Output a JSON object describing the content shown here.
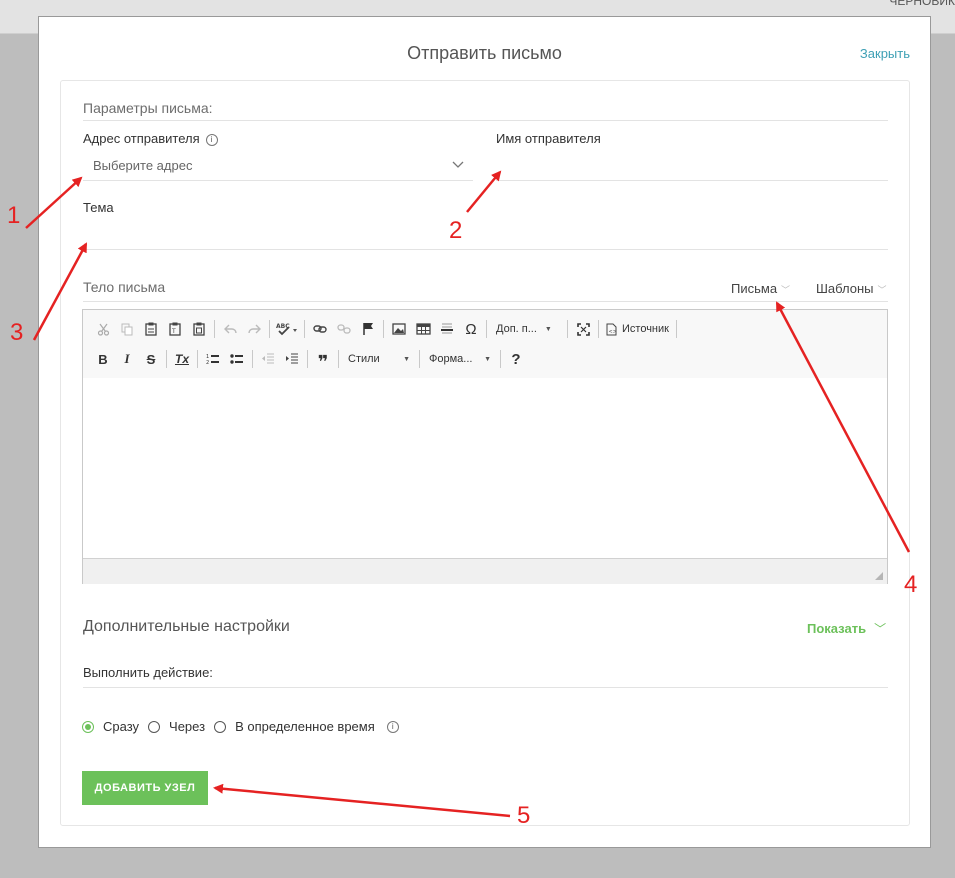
{
  "background": {
    "corner_text": "ЧЕРНОВИК"
  },
  "modal": {
    "title": "Отправить письмо",
    "close_label": "Закрыть"
  },
  "params": {
    "section_label": "Параметры письма:",
    "sender_address_label": "Адрес отправителя",
    "sender_address_placeholder": "Выберите адрес",
    "sender_name_label": "Имя отправителя",
    "subject_label": "Тема"
  },
  "body": {
    "label": "Тело письма",
    "letters_link": "Письма",
    "templates_link": "Шаблоны"
  },
  "editor": {
    "icons_row1": [
      "cut-icon",
      "copy-icon",
      "paste-icon",
      "paste-text-icon",
      "paste-word-icon",
      "undo-icon",
      "redo-icon",
      "spellcheck-icon",
      "link-icon",
      "unlink-icon",
      "anchor-icon",
      "image-icon",
      "table-icon",
      "horizontal-line-icon",
      "special-char-icon",
      "maximize-icon",
      "source-icon"
    ],
    "extra_combo": "Доп. п...",
    "source_label": "Источник",
    "styles_combo": "Стили",
    "format_combo": "Форма...",
    "help_glyph": "?",
    "bold_glyph": "B",
    "italic_glyph": "I",
    "strike_glyph": "S",
    "clear_glyph": "Tx",
    "quote_glyph": "❞"
  },
  "advanced": {
    "title": "Дополнительные настройки",
    "show_label": "Показать",
    "action_label": "Выполнить действие:",
    "options": [
      {
        "label": "Сразу",
        "selected": true
      },
      {
        "label": "Через",
        "selected": false
      },
      {
        "label": "В определенное время",
        "selected": false
      }
    ]
  },
  "add_button_label": "ДОБАВИТЬ УЗЕЛ",
  "annotations": [
    "1",
    "2",
    "3",
    "4",
    "5"
  ],
  "colors": {
    "accent_green": "#6cc15a",
    "link_teal": "#3fa0b5",
    "annotation_red": "#e52222"
  }
}
